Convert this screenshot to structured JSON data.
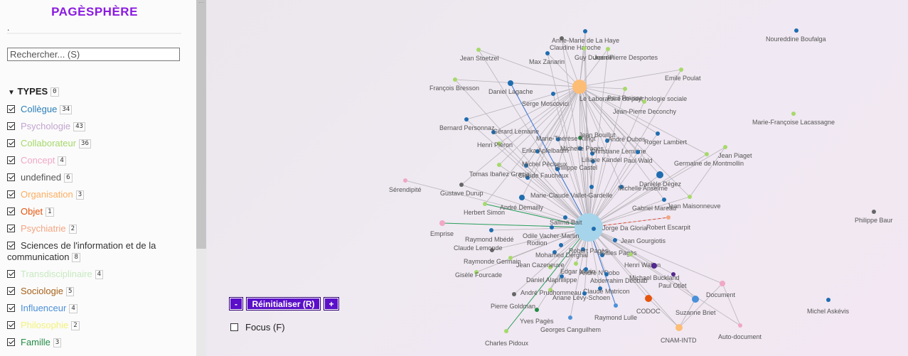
{
  "app": {
    "title": "PAGÈSPHÈRE",
    "dot": "."
  },
  "search": {
    "placeholder": "Rechercher... (S)",
    "value": ""
  },
  "types": {
    "header": "TYPES",
    "count": "0",
    "items": [
      {
        "label": "Collègue",
        "count": "34",
        "color": "#2c7fb8"
      },
      {
        "label": "Psychologie",
        "count": "43",
        "color": "#c2a5cf"
      },
      {
        "label": "Collaborateur",
        "count": "36",
        "color": "#a6d96a"
      },
      {
        "label": "Concept",
        "count": "4",
        "color": "#f1a7c6"
      },
      {
        "label": "undefined",
        "count": "6",
        "color": "#555555"
      },
      {
        "label": "Organisation",
        "count": "3",
        "color": "#fdae61"
      },
      {
        "label": "Objet",
        "count": "1",
        "color": "#e6550d"
      },
      {
        "label": "Psychiatrie",
        "count": "2",
        "color": "#f4a582"
      },
      {
        "label": "Sciences de l'information et de la communication",
        "count": "8",
        "color": "#333333"
      },
      {
        "label": "Transdisciplinaire",
        "count": "4",
        "color": "#c7e9c0"
      },
      {
        "label": "Sociologie",
        "count": "5",
        "color": "#a6611a"
      },
      {
        "label": "Influenceur",
        "count": "4",
        "color": "#4a90d9"
      },
      {
        "label": "Philosophie",
        "count": "2",
        "color": "#f2f27a"
      },
      {
        "label": "Famille",
        "count": "3",
        "color": "#238b45"
      }
    ]
  },
  "controls": {
    "minus": "-",
    "reset": "Réinitialiser (R)",
    "plus": "+",
    "focus": "Focus (F)"
  },
  "graph": {
    "nodes": [
      {
        "id": "hub",
        "label": "",
        "color": "#a6d4ea"
      },
      {
        "id": "lab",
        "label": "Le Laboratoire de psychologie sociale",
        "color": "#fdbd74"
      },
      {
        "id": "n1",
        "label": "Anne-Marie de La Haye",
        "color": "#666666"
      },
      {
        "id": "n2",
        "label": "Claudine Haroche",
        "color": "#1f6db0"
      },
      {
        "id": "n3",
        "label": "Guy Durandin",
        "color": "#a6d96a"
      },
      {
        "id": "n4",
        "label": "Jean-Pierre Desportes",
        "color": "#a6d96a"
      },
      {
        "id": "n5",
        "label": "Max Zanarin",
        "color": "#1f6db0"
      },
      {
        "id": "n6",
        "label": "Jean Stoetzel",
        "color": "#a6d96a"
      },
      {
        "id": "n7",
        "label": "Noureddine Boufalga",
        "color": "#1f6db0"
      },
      {
        "id": "n8",
        "label": "Emile Poulat",
        "color": "#a6d96a"
      },
      {
        "id": "n9",
        "label": "François Bresson",
        "color": "#a6d96a"
      },
      {
        "id": "n10",
        "label": "Daniel Lagache",
        "color": "#1f6db0"
      },
      {
        "id": "n11",
        "label": "Serge Moscovici",
        "color": "#1f6db0"
      },
      {
        "id": "n12",
        "label": "Paul Fraisse",
        "color": "#a6d96a"
      },
      {
        "id": "n13",
        "label": "Jean-Pierre Deconchy",
        "color": "#a6d96a"
      },
      {
        "id": "n14",
        "label": "Marie-Françoise Lacassagne",
        "color": "#a6d96a"
      },
      {
        "id": "n15",
        "label": "Bernard Personnaz",
        "color": "#1f6db0"
      },
      {
        "id": "n16",
        "label": "Gérard Lemaine",
        "color": "#1f6db0"
      },
      {
        "id": "n17",
        "label": "Jean Bouillut",
        "color": "#238b45"
      },
      {
        "id": "n18",
        "label": "Marie-Thérèse Klingt",
        "color": "#1f6db0"
      },
      {
        "id": "n19",
        "label": "André Dubos",
        "color": "#1f6db0"
      },
      {
        "id": "n20",
        "label": "Roger Lambert",
        "color": "#1f6db0"
      },
      {
        "id": "n21",
        "label": "Henri Piéron",
        "color": "#a6d96a"
      },
      {
        "id": "n22",
        "label": "Michelle Pagès",
        "color": "#1f6db0"
      },
      {
        "id": "n23",
        "label": "Erika Apfelbaum",
        "color": "#1f6db0"
      },
      {
        "id": "n24",
        "label": "Christiane Lemaine",
        "color": "#1f6db0"
      },
      {
        "id": "n25",
        "label": "Jean Piaget",
        "color": "#a6d96a"
      },
      {
        "id": "n26",
        "label": "Liliane Kandel",
        "color": "#1f6db0"
      },
      {
        "id": "n27",
        "label": "Paul Wald",
        "color": "#1f6db0"
      },
      {
        "id": "n28",
        "label": "Germaine de Montmollin",
        "color": "#a6d96a"
      },
      {
        "id": "n29",
        "label": "Michel Pêcheux",
        "color": "#1f6db0"
      },
      {
        "id": "n30",
        "label": "Philippe Castel",
        "color": "#1f6db0"
      },
      {
        "id": "n31",
        "label": "Tomas Ibañez Gracia",
        "color": "#a6d96a"
      },
      {
        "id": "n32",
        "label": "Claude Faucheux",
        "color": "#1f6db0"
      },
      {
        "id": "n33",
        "label": "Sérendipité",
        "color": "#f1a7c6"
      },
      {
        "id": "n34",
        "label": "Gustave Durup",
        "color": "#666666"
      },
      {
        "id": "n35",
        "label": "Marie-Claude Vallet-Gardelle",
        "color": "#1f6db0"
      },
      {
        "id": "n36",
        "label": "Michelle Anselme",
        "color": "#1f6db0"
      },
      {
        "id": "n37",
        "label": "Danièle Dégez",
        "color": "#1f6db0"
      },
      {
        "id": "n38",
        "label": "André Demailly",
        "color": "#1f6db0"
      },
      {
        "id": "n39",
        "label": "Gabriel Mareau",
        "color": "#1f6db0"
      },
      {
        "id": "n40",
        "label": "Jean Maisonneuve",
        "color": "#a6d96a"
      },
      {
        "id": "n41",
        "label": "Philippe Baur",
        "color": "#666666"
      },
      {
        "id": "n42",
        "label": "Herbert Simon",
        "color": "#a6d96a"
      },
      {
        "id": "n43",
        "label": "Salima Bait",
        "color": "#1f6db0"
      },
      {
        "id": "n44",
        "label": "Robert Escarpit",
        "color": "#f4a582"
      },
      {
        "id": "n45",
        "label": "Emprise",
        "color": "#f1a7c6"
      },
      {
        "id": "n46",
        "label": "Odile Vacher-Martin",
        "color": "#1f6db0"
      },
      {
        "id": "n47",
        "label": "Jorge Da Gloria",
        "color": "#1f6db0"
      },
      {
        "id": "n48",
        "label": "Raymond Mbédé",
        "color": "#1f6db0"
      },
      {
        "id": "n49",
        "label": "Rodion",
        "color": "#1f6db0"
      },
      {
        "id": "n50",
        "label": "Jean Gourgiotis",
        "color": "#1f6db0"
      },
      {
        "id": "n51",
        "label": "Claude Lemonde",
        "color": "#666666"
      },
      {
        "id": "n52",
        "label": "Robert Pagès",
        "color": "#1f6db0"
      },
      {
        "id": "n53",
        "label": "Gilles Pagès",
        "color": "#1f6db0"
      },
      {
        "id": "n54",
        "label": "Mohamed Derghal",
        "color": "#1f6db0"
      },
      {
        "id": "n55",
        "label": "Raymonde Germain",
        "color": "#a6d96a"
      },
      {
        "id": "n56",
        "label": "Jean Cazeneuve",
        "color": "#a6d96a"
      },
      {
        "id": "n57",
        "label": "Henri Wallon",
        "color": "#a6d96a"
      },
      {
        "id": "n58",
        "label": "Gisèle Fourcade",
        "color": "#a6d96a"
      },
      {
        "id": "n59",
        "label": "Edgar Morin",
        "color": "#a6d96a"
      },
      {
        "id": "n60",
        "label": "André N'Dobo",
        "color": "#1f6db0"
      },
      {
        "id": "n61",
        "label": "Daniel Alaphilippe",
        "color": "#1f6db0"
      },
      {
        "id": "n62",
        "label": "Abderrahim Debbab",
        "color": "#1f6db0"
      },
      {
        "id": "n63",
        "label": "Michael Buckland",
        "color": "#54278f"
      },
      {
        "id": "n64",
        "label": "Paul Otlet",
        "color": "#54278f"
      },
      {
        "id": "n65",
        "label": "André Prudhommeau",
        "color": "#a6d96a"
      },
      {
        "id": "n66",
        "label": "Claude Matricon",
        "color": "#1f6db0"
      },
      {
        "id": "n67",
        "label": "Ariane Lévy-Schoen",
        "color": "#1f6db0"
      },
      {
        "id": "n68",
        "label": "Document",
        "color": "#f1a7c6"
      },
      {
        "id": "n69",
        "label": "Pierre Goldman",
        "color": "#666666"
      },
      {
        "id": "n70",
        "label": "CODOC",
        "color": "#e6550d"
      },
      {
        "id": "n71",
        "label": "Raymond Lulle",
        "color": "#4a90d9"
      },
      {
        "id": "n72",
        "label": "Suzanne Briet",
        "color": "#4a90d9"
      },
      {
        "id": "n73",
        "label": "Michel Askévis",
        "color": "#1f6db0"
      },
      {
        "id": "n74",
        "label": "Yves Pagès",
        "color": "#238b45"
      },
      {
        "id": "n75",
        "label": "Georges Canguilhem",
        "color": "#4a90d9"
      },
      {
        "id": "n76",
        "label": "CNAM-INTD",
        "color": "#fdbd74"
      },
      {
        "id": "n77",
        "label": "Auto-document",
        "color": "#f1a7c6"
      },
      {
        "id": "n78",
        "label": "Charles Pidoux",
        "color": "#a6d96a"
      }
    ]
  }
}
